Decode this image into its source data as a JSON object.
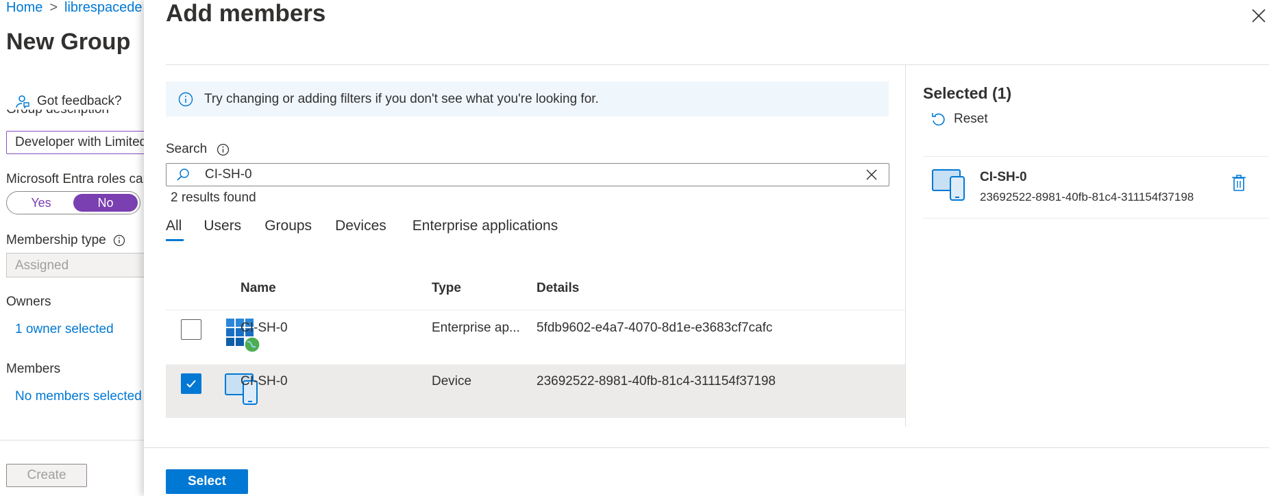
{
  "background": {
    "breadcrumb": {
      "home": "Home",
      "separator": ">",
      "tenant": "librespacede"
    },
    "title": "New Group",
    "feedback": "Got feedback?",
    "group_description_label": "Group description",
    "group_description_value": "Developer with Limited",
    "roles_label": "Microsoft Entra roles can",
    "toggle": {
      "yes": "Yes",
      "no": "No",
      "selected": "No"
    },
    "membership_type_label": "Membership type",
    "membership_type_value": "Assigned",
    "owners_label": "Owners",
    "owners_link": "1 owner selected",
    "members_label": "Members",
    "members_link": "No members selected",
    "create_label": "Create"
  },
  "panel": {
    "title": "Add members",
    "info_text": "Try changing or adding filters if you don't see what you're looking for.",
    "search": {
      "label": "Search",
      "value": "CI-SH-0"
    },
    "results_text": "2 results found",
    "tabs": [
      {
        "label": "All",
        "active": true
      },
      {
        "label": "Users"
      },
      {
        "label": "Groups"
      },
      {
        "label": "Devices"
      },
      {
        "label": "Enterprise applications"
      }
    ],
    "table": {
      "headers": {
        "name": "Name",
        "type": "Type",
        "details": "Details"
      },
      "rows": [
        {
          "name": "CI-SH-0",
          "type": "Enterprise ap...",
          "details": "5fdb9602-e4a7-4070-8d1e-e3683cf7cafc",
          "checked": false,
          "icon": "enterprise-app-icon"
        },
        {
          "name": "CI-SH-0",
          "type": "Device",
          "details": "23692522-8981-40fb-81c4-311154f37198",
          "checked": true,
          "icon": "device-icon"
        }
      ]
    },
    "selected": {
      "title": "Selected (1)",
      "reset_label": "Reset",
      "items": [
        {
          "name": "CI-SH-0",
          "id": "23692522-8981-40fb-81c4-311154f37198",
          "icon": "device-icon"
        }
      ]
    },
    "select_label": "Select"
  },
  "colors": {
    "accent": "#0078d4",
    "toggle_purple": "#7a3fb0",
    "row_selected": "#edebe9",
    "info_bar": "#eff6fc"
  }
}
